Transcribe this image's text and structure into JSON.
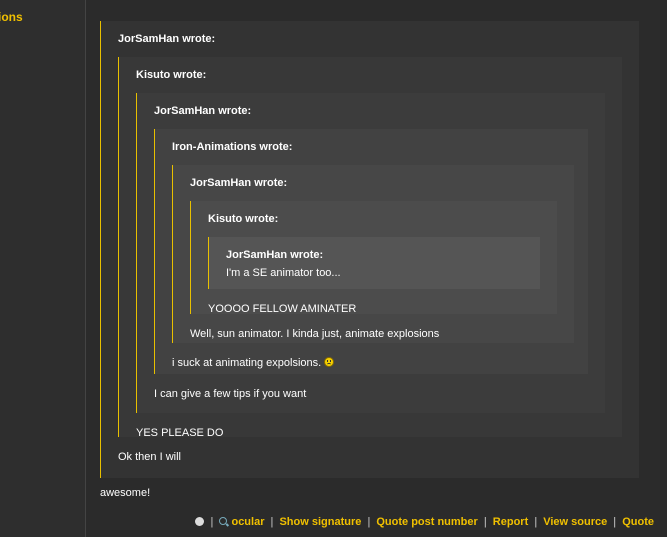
{
  "sidebar": {
    "title": "ions"
  },
  "quotes": {
    "q0_author": "JorSamHan wrote:",
    "q1_author": "Kisuto wrote:",
    "q2_author": "JorSamHan wrote:",
    "q3_author": "Iron-Animations wrote:",
    "q4_author": "JorSamHan wrote:",
    "q5_author": "Kisuto wrote:",
    "q6_author": "JorSamHan wrote:",
    "q6_text": "I'm a SE animator too...",
    "q5_text": "YOOOO FELLOW AMINATER",
    "q4_text": "Well, sun animator. I kinda just, animate explosions",
    "q3_text": "i suck at animating expolsions.",
    "q2_text": "I can give a few tips if you want",
    "q1_text": "YES PLEASE DO",
    "q0_text": "Ok then I will"
  },
  "post": {
    "body": "awesome!"
  },
  "footer": {
    "ocular": "ocular",
    "show_signature": "Show signature",
    "quote_post_number": "Quote post number",
    "report": "Report",
    "view_source": "View source",
    "quote": "Quote",
    "separator": "|"
  },
  "icons": {
    "sad": "sad-smiley-icon",
    "face": "face-icon",
    "search": "magnifier-icon"
  },
  "colors": {
    "accent": "#f0c000",
    "quote_border": "#e8c000"
  }
}
